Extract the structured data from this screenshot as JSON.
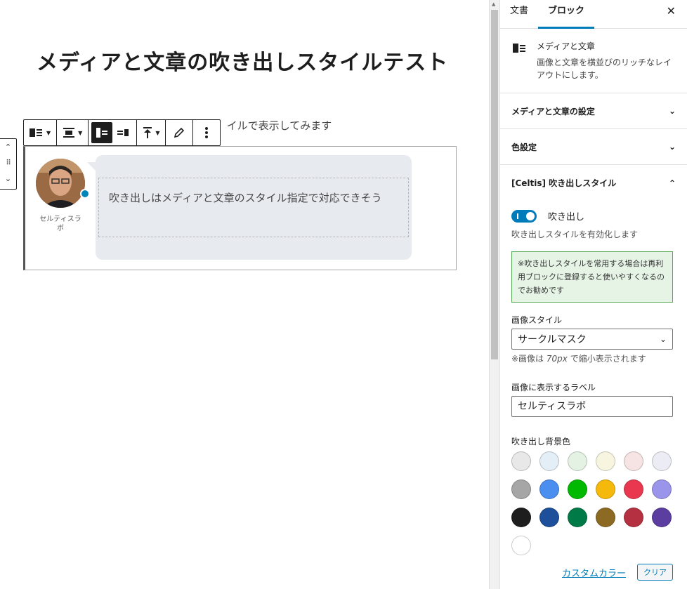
{
  "editor": {
    "post_title": "メディアと文章の吹き出しスタイルテスト",
    "paragraph_behind": "メディアと文章の吹き出しスタイルで表示してみます",
    "mover": {
      "up": "⌃",
      "drag": "⠿",
      "down": "⌄"
    },
    "block": {
      "avatar_label": "セルティスラボ",
      "bubble_text": "吹き出しはメディアと文章のスタイル指定で対応できそう"
    }
  },
  "sidebar": {
    "tabs": [
      {
        "label": "文書",
        "active": false
      },
      {
        "label": "ブロック",
        "active": true
      }
    ],
    "close": "✕",
    "block_card": {
      "icon": "media-text-icon",
      "title": "メディアと文章",
      "description": "画像と文章を横並びのリッチなレイアウトにします。"
    },
    "panels": [
      {
        "label": "メディアと文章の設定",
        "open": false
      },
      {
        "label": "色設定",
        "open": false
      }
    ],
    "balloon_panel": {
      "label": "[Celtis] 吹き出しスタイル",
      "toggle_label": "吹き出し",
      "toggle_on": true,
      "toggle_help": "吹き出しスタイルを有効化します",
      "notice": "※吹き出しスタイルを常用する場合は再利用ブロックに登録すると使いやすくなるのでお勧めです",
      "image_style_label": "画像スタイル",
      "image_style_value": "サークルマスク",
      "image_note_prefix": "※画像は ",
      "image_note_size": "70px",
      "image_note_suffix": " で縮小表示されます",
      "label_field_label": "画像に表示するラベル",
      "label_field_value": "セルティスラボ",
      "bg_color_label": "吹き出し背景色",
      "swatches": [
        "#e8e8e8",
        "#e3eef6",
        "#e3f2e3",
        "#f7f5df",
        "#f6e3e3",
        "#ececf4",
        "#a6a6a6",
        "#4a8ef0",
        "#00b900",
        "#f4b90a",
        "#e8374f",
        "#9a94ea",
        "#1e1e1e",
        "#1d4f9a",
        "#007a46",
        "#8d6a23",
        "#b53141",
        "#5b3ea0",
        "#ffffff"
      ],
      "custom_color": "カスタムカラー",
      "clear": "クリア"
    }
  },
  "colors": {
    "accent": "#007cba",
    "dot": "#0085ba",
    "bubble_bg": "#e7ebf0",
    "notice_bg": "#e6f4e6",
    "notice_border": "#57a957"
  }
}
